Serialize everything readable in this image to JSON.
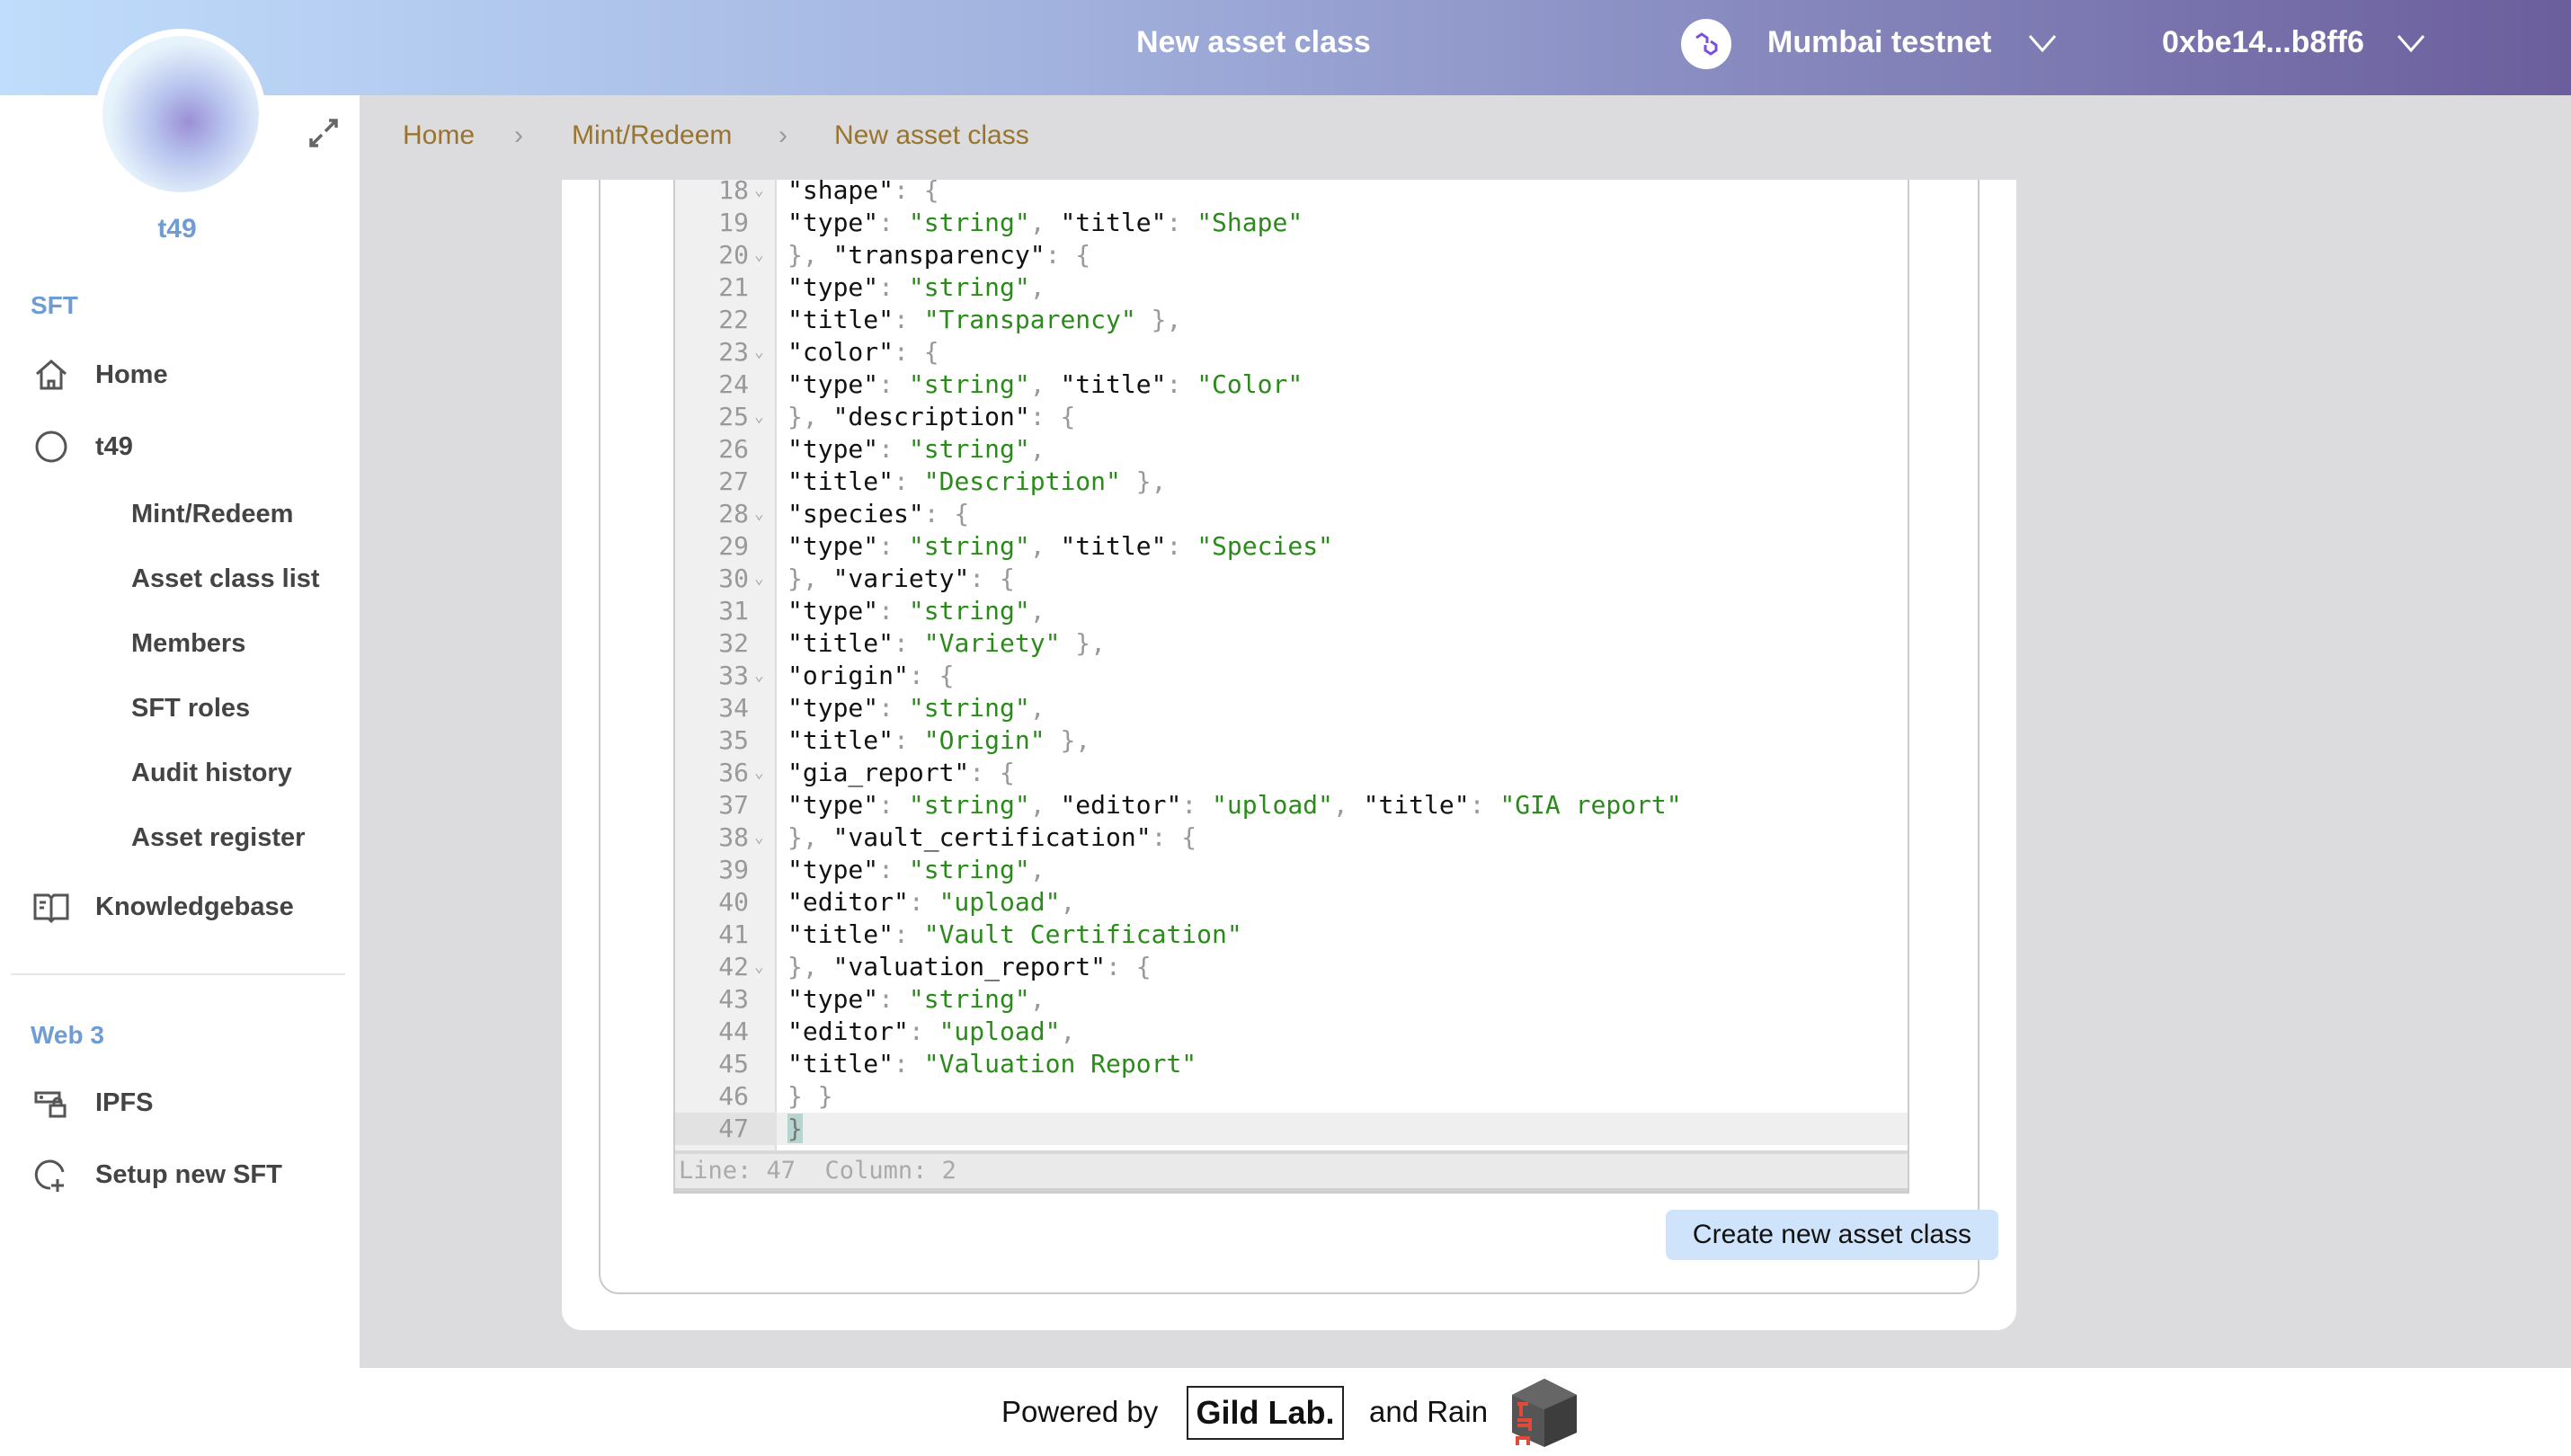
{
  "header": {
    "title": "New asset class",
    "network": "Mumbai testnet",
    "address": "0xbe14...b8ff6",
    "network_icon": "polygon-icon",
    "gradient": [
      "#c0ddfc",
      "#6b5e9c"
    ]
  },
  "sidebar": {
    "user": "t49",
    "section_sft": "SFT",
    "items": [
      {
        "label": "Home",
        "icon": "home-icon"
      },
      {
        "label": "t49",
        "icon": "circle-icon"
      }
    ],
    "sub_items": [
      "Mint/Redeem",
      "Asset class list",
      "Members",
      "SFT roles",
      "Audit history",
      "Asset register"
    ],
    "knowledgebase": "Knowledgebase",
    "section_web3": "Web 3",
    "web3_items": [
      {
        "label": "IPFS",
        "icon": "ipfs-icon"
      },
      {
        "label": "Setup new SFT",
        "icon": "add-circle-icon"
      }
    ]
  },
  "breadcrumb": [
    "Home",
    "Mint/Redeem",
    "New asset class"
  ],
  "editor": {
    "lines": [
      {
        "n": "18",
        "fold": true,
        "text": "\"shape\": {"
      },
      {
        "n": "19",
        "text": "\"type\": \"string\", \"title\": \"Shape\""
      },
      {
        "n": "20",
        "fold": true,
        "text": "}, \"transparency\": {"
      },
      {
        "n": "21",
        "text": "\"type\": \"string\","
      },
      {
        "n": "22",
        "text": "\"title\": \"Transparency\" },"
      },
      {
        "n": "23",
        "fold": true,
        "text": "\"color\": {"
      },
      {
        "n": "24",
        "text": "\"type\": \"string\", \"title\": \"Color\""
      },
      {
        "n": "25",
        "fold": true,
        "text": "}, \"description\": {"
      },
      {
        "n": "26",
        "text": "\"type\": \"string\","
      },
      {
        "n": "27",
        "text": "\"title\": \"Description\" },"
      },
      {
        "n": "28",
        "fold": true,
        "text": "\"species\": {"
      },
      {
        "n": "29",
        "text": "\"type\": \"string\", \"title\": \"Species\""
      },
      {
        "n": "30",
        "fold": true,
        "text": "}, \"variety\": {"
      },
      {
        "n": "31",
        "text": "\"type\": \"string\","
      },
      {
        "n": "32",
        "text": "\"title\": \"Variety\" },"
      },
      {
        "n": "33",
        "fold": true,
        "text": "\"origin\": {"
      },
      {
        "n": "34",
        "text": "\"type\": \"string\","
      },
      {
        "n": "35",
        "text": "\"title\": \"Origin\" },"
      },
      {
        "n": "36",
        "fold": true,
        "text": "\"gia_report\": {"
      },
      {
        "n": "37",
        "text": "\"type\": \"string\", \"editor\": \"upload\", \"title\": \"GIA report\""
      },
      {
        "n": "38",
        "fold": true,
        "text": "}, \"vault_certification\": {"
      },
      {
        "n": "39",
        "text": "\"type\": \"string\","
      },
      {
        "n": "40",
        "text": "\"editor\": \"upload\","
      },
      {
        "n": "41",
        "text": "\"title\": \"Vault Certification\""
      },
      {
        "n": "42",
        "fold": true,
        "text": "}, \"valuation_report\": {"
      },
      {
        "n": "43",
        "text": "\"type\": \"string\","
      },
      {
        "n": "44",
        "text": "\"editor\": \"upload\","
      },
      {
        "n": "45",
        "text": "\"title\": \"Valuation Report\""
      },
      {
        "n": "46",
        "text": "} }"
      },
      {
        "n": "47",
        "text": "}",
        "active": true
      }
    ],
    "status": "Line: 47  Column: 2",
    "colors": {
      "key": "#111111",
      "string": "#2a8a1a",
      "punct": "#999999"
    }
  },
  "create_button": "Create new asset class",
  "footer": {
    "powered_by": "Powered by",
    "gild": "Gild Lab.",
    "and_rain": "and Rain",
    "rain_logo_text": "rain"
  }
}
